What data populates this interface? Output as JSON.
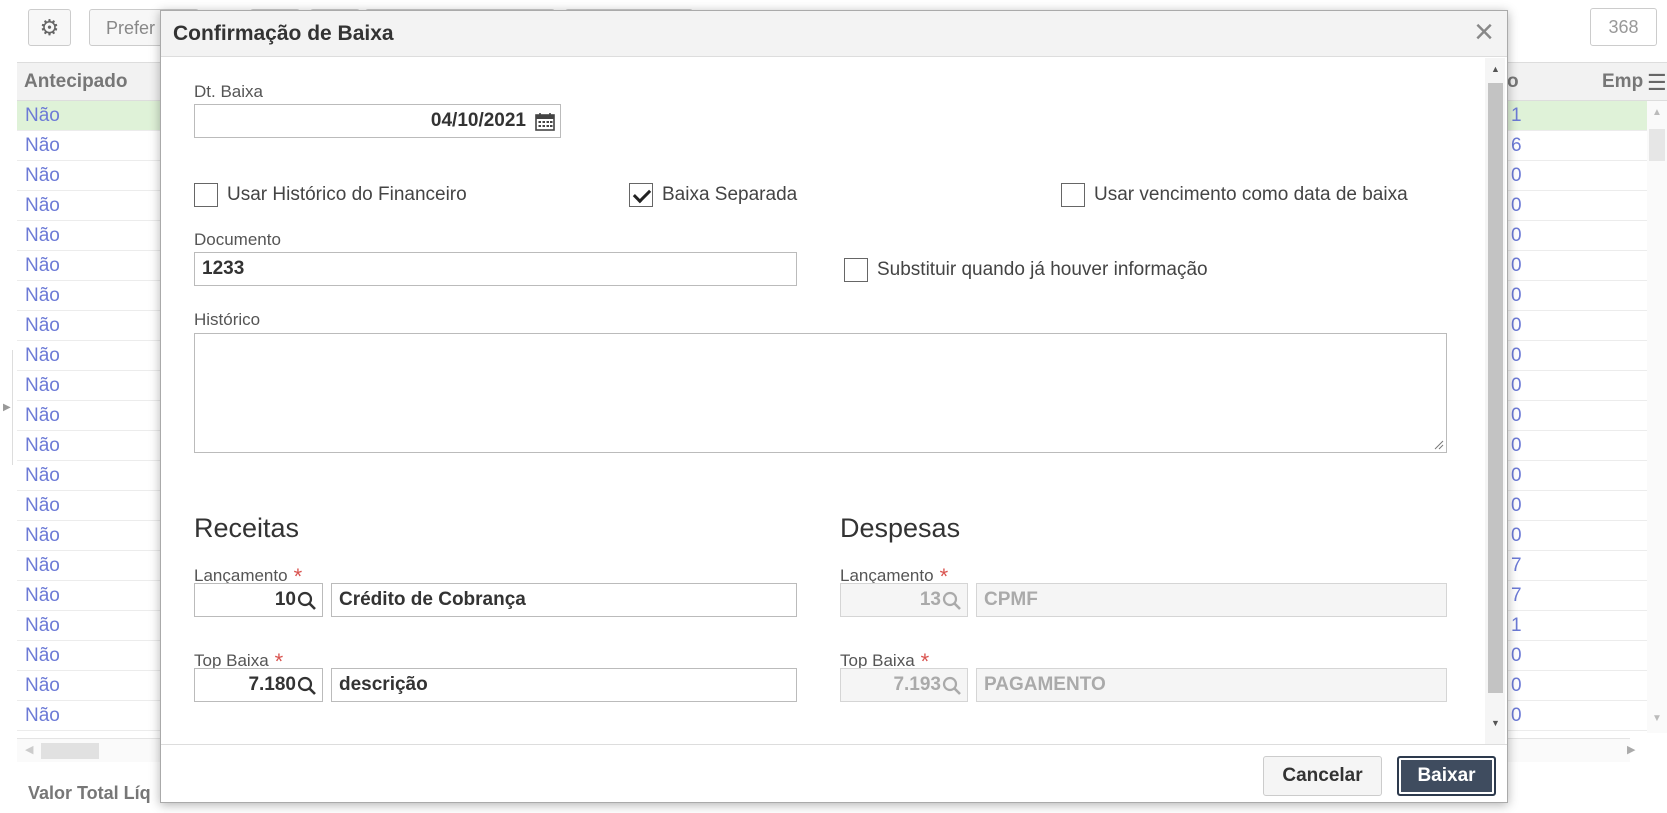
{
  "background": {
    "toolbar": {
      "preferences_label": "Prefer",
      "count": "368"
    },
    "grid": {
      "columns": [
        "Antecipado",
        "o",
        "Emp"
      ],
      "rows": [
        {
          "antecipado": "Não",
          "tail": "1"
        },
        {
          "antecipado": "Não",
          "tail": "6"
        },
        {
          "antecipado": "Não",
          "tail": "0"
        },
        {
          "antecipado": "Não",
          "tail": "0"
        },
        {
          "antecipado": "Não",
          "tail": "0"
        },
        {
          "antecipado": "Não",
          "tail": "0"
        },
        {
          "antecipado": "Não",
          "tail": "0"
        },
        {
          "antecipado": "Não",
          "tail": "0"
        },
        {
          "antecipado": "Não",
          "tail": "0"
        },
        {
          "antecipado": "Não",
          "tail": "0"
        },
        {
          "antecipado": "Não",
          "tail": "0"
        },
        {
          "antecipado": "Não",
          "tail": "0"
        },
        {
          "antecipado": "Não",
          "tail": "0"
        },
        {
          "antecipado": "Não",
          "tail": "0"
        },
        {
          "antecipado": "Não",
          "tail": "0"
        },
        {
          "antecipado": "Não",
          "tail": "7"
        },
        {
          "antecipado": "Não",
          "tail": "7"
        },
        {
          "antecipado": "Não",
          "tail": "1"
        },
        {
          "antecipado": "Não",
          "tail": "0"
        },
        {
          "antecipado": "Não",
          "tail": "0"
        },
        {
          "antecipado": "Não",
          "tail": "0"
        }
      ]
    },
    "footer_label": "Valor Total Líq"
  },
  "modal": {
    "title": "Confirmação de Baixa",
    "dt_baixa": {
      "label": "Dt. Baixa",
      "value": "04/10/2021"
    },
    "checkboxes": {
      "usar_historico": {
        "label": "Usar Histórico do Financeiro",
        "checked": false
      },
      "baixa_separada": {
        "label": "Baixa Separada",
        "checked": true
      },
      "usar_vencimento": {
        "label": "Usar vencimento como data de baixa",
        "checked": false
      },
      "substituir": {
        "label": "Substituir quando já houver informação",
        "checked": false
      }
    },
    "documento": {
      "label": "Documento",
      "value": "1233"
    },
    "historico": {
      "label": "Histórico",
      "value": ""
    },
    "receitas": {
      "title": "Receitas",
      "lancamento": {
        "label": "Lançamento",
        "code": "10",
        "description": "Crédito de Cobrança"
      },
      "top_baixa": {
        "label": "Top Baixa",
        "code": "7.180",
        "description": "descrição"
      }
    },
    "despesas": {
      "title": "Despesas",
      "lancamento": {
        "label": "Lançamento",
        "code": "13",
        "description": "CPMF"
      },
      "top_baixa": {
        "label": "Top Baixa",
        "code": "7.193",
        "description": "PAGAMENTO"
      }
    },
    "required_mark": "*",
    "buttons": {
      "cancel": "Cancelar",
      "confirm": "Baixar"
    }
  },
  "colors": {
    "link_blue": "#6c7ad6",
    "selected_row": "#dff2d8",
    "required_red": "#d9534f",
    "primary_button": "#3f4c5f"
  },
  "icons": [
    "gear-icon",
    "calendar-icon",
    "search-icon",
    "close-icon",
    "menu-icon"
  ]
}
